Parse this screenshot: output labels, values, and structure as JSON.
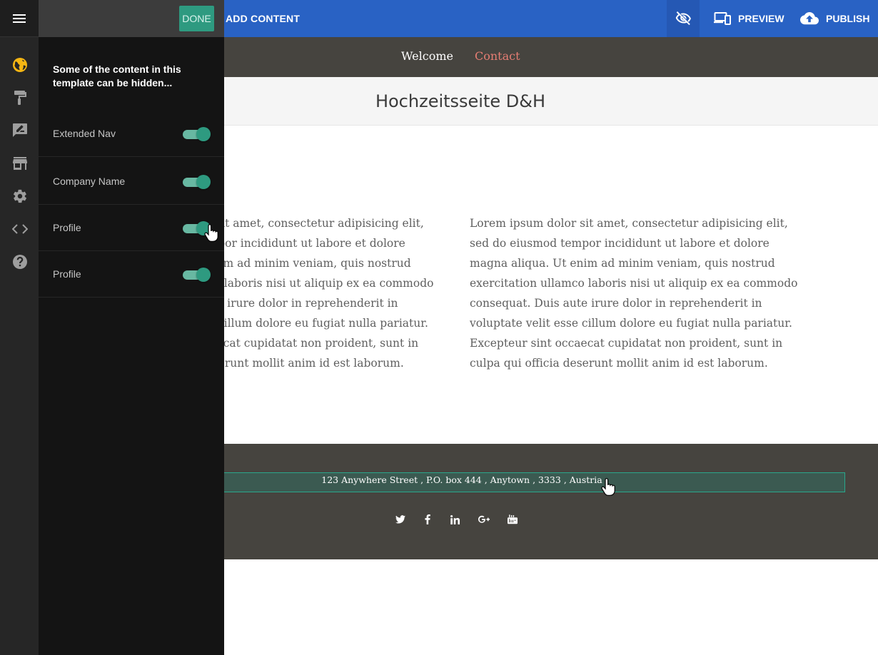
{
  "topbar": {
    "add_content": "ADD CONTENT",
    "preview": "PREVIEW",
    "publish": "PUBLISH",
    "accent_color": "#2962c4"
  },
  "panel": {
    "done": "DONE",
    "intro": "Some of the content in this template can be hidden...",
    "toggles": [
      {
        "label": "Extended Nav",
        "on": true
      },
      {
        "label": "Company Name",
        "on": true
      },
      {
        "label": "Profile",
        "on": true
      },
      {
        "label": "Profile",
        "on": true
      }
    ],
    "toggle_color": "#2e9a80"
  },
  "rail": {
    "icons": [
      "globe-icon",
      "paint-roller-icon",
      "edit-note-icon",
      "store-icon",
      "gear-icon",
      "code-icon",
      "help-icon"
    ]
  },
  "site": {
    "nav": {
      "welcome": "Welcome",
      "contact": "Contact"
    },
    "title": "Hochzeitsseite D&H",
    "col_left": "Lorem ipsum dolor sit amet, consectetur adipisicing elit, sed do eiusmod tempor incididunt ut labore et dolore magna aliqua. Ut enim ad minim veniam, quis nostrud exercitation ullamco laboris nisi ut aliquip ex ea commodo consequat. Duis aute irure dolor in reprehenderit in voluptate velit esse cillum dolore eu fugiat nulla pariatur. Excepteur sint occaecat cupidatat non proident, sunt in culpa qui officia deserunt mollit anim id est laborum.",
    "col_right": "Lorem ipsum dolor sit amet, consectetur adipisicing elit, sed do eiusmod tempor incididunt ut labore et dolore magna aliqua. Ut enim ad minim veniam, quis nostrud exercitation ullamco laboris nisi ut aliquip ex ea commodo consequat. Duis aute irure dolor in reprehenderit in voluptate velit esse cillum dolore eu fugiat nulla pariatur. Excepteur sint occaecat cupidatat non proident, sunt in culpa qui officia deserunt mollit anim id est laborum.",
    "address": "123 Anywhere Street , P.O. box 444 , Anytown , 3333 , Austria",
    "social": [
      "twitter-icon",
      "facebook-icon",
      "linkedin-icon",
      "google-plus-icon",
      "youtube-icon"
    ]
  }
}
